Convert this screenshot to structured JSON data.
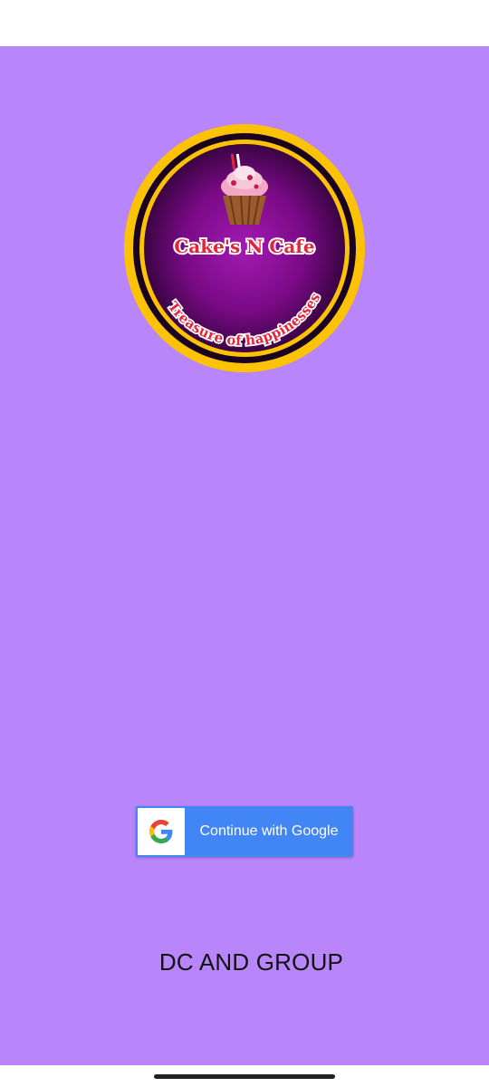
{
  "colors": {
    "background": "#b985fb",
    "google_button": "#4285f4",
    "logo_ring": "#fcc205",
    "logo_inner": "#7a0a86",
    "logo_text": "#e5243c"
  },
  "logo": {
    "title": "Cake's N Cafe",
    "tagline": "Treasure of happinesses"
  },
  "google_signin": {
    "icon": "google-g-icon",
    "label": "Continue with Google"
  },
  "footer": {
    "text": "DC AND GROUP"
  }
}
